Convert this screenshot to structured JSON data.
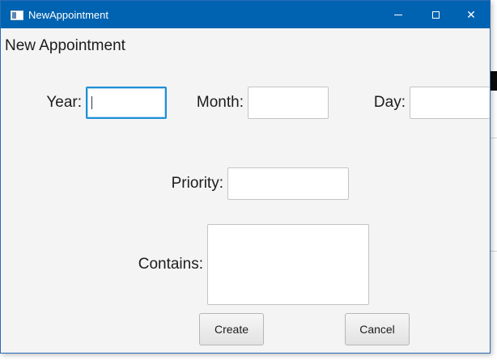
{
  "window": {
    "title": "NewAppointment",
    "accent": "#0063b1"
  },
  "form": {
    "heading": "New Appointment",
    "year_label": "Year:",
    "year_value": "",
    "month_label": "Month:",
    "month_value": "",
    "day_label": "Day:",
    "day_value": "",
    "priority_label": "Priority:",
    "priority_value": "",
    "contains_label": "Contains:",
    "contains_value": ""
  },
  "buttons": {
    "create_label": "Create",
    "cancel_label": "Cancel",
    "minimize_icon": "minimize-icon",
    "maximize_icon": "maximize-icon",
    "close_icon": "close-icon",
    "close_glyph": "✕"
  }
}
